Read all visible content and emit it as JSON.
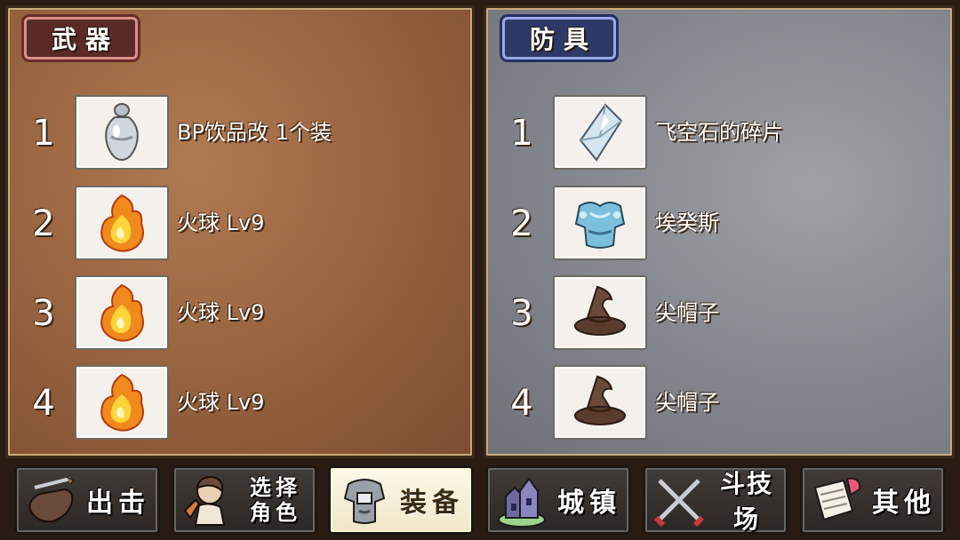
{
  "weapons": {
    "tab_label": "武器",
    "slots": [
      {
        "num": "1",
        "name": "BP饮品改 1个装",
        "icon": "potion-icon"
      },
      {
        "num": "2",
        "name": "火球 Lv9",
        "icon": "fireball-icon"
      },
      {
        "num": "3",
        "name": "火球 Lv9",
        "icon": "fireball-icon"
      },
      {
        "num": "4",
        "name": "火球 Lv9",
        "icon": "fireball-icon"
      }
    ]
  },
  "armor": {
    "tab_label": "防具",
    "slots": [
      {
        "num": "1",
        "name": "飞空石的碎片",
        "icon": "crystal-shard-icon"
      },
      {
        "num": "2",
        "name": "埃癸斯",
        "icon": "armor-icon"
      },
      {
        "num": "3",
        "name": "尖帽子",
        "icon": "pointed-hat-icon"
      },
      {
        "num": "4",
        "name": "尖帽子",
        "icon": "pointed-hat-icon"
      }
    ]
  },
  "nav": {
    "attack": "出击",
    "select_character": "选择\n角色",
    "equipment": "装备",
    "town": "城镇",
    "arena": "斗技场",
    "other": "其他"
  },
  "colors": {
    "weapon_panel": "#9a6541",
    "armor_panel": "#878a90",
    "weapon_tab": "#5a2a26",
    "armor_tab": "#2d3966",
    "active_nav": "#fdf8e8"
  }
}
